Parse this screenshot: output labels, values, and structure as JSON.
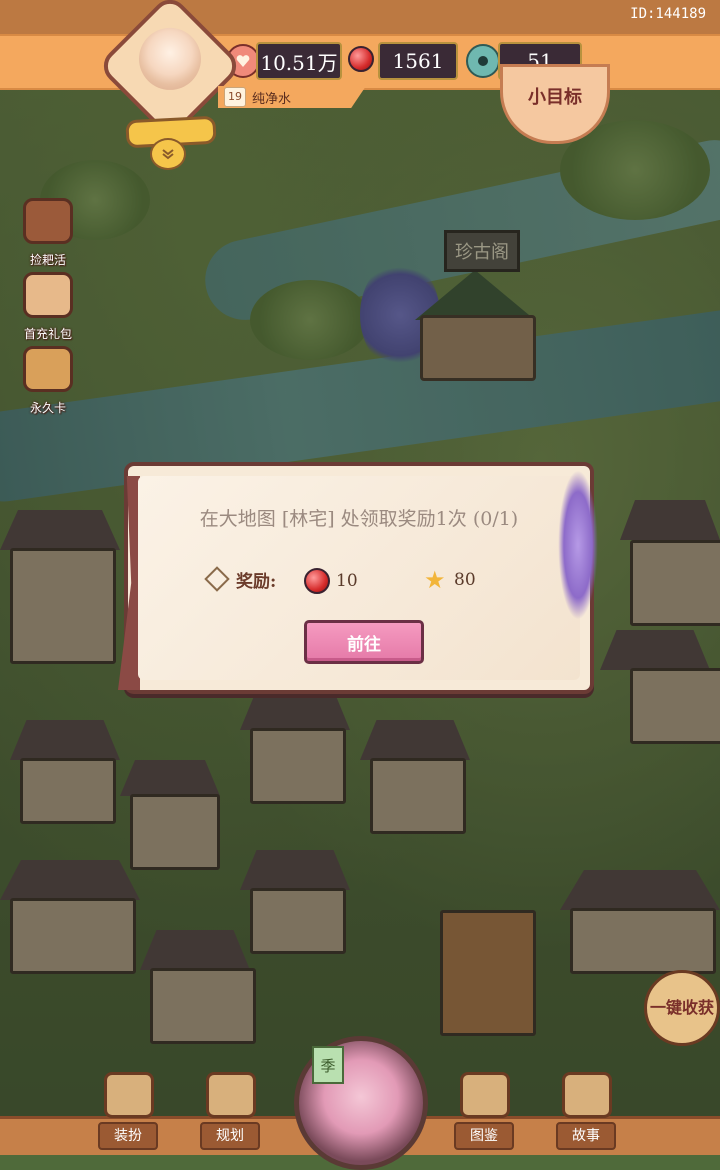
{
  "header": {
    "user_id": "ID:144189",
    "resources": [
      {
        "icon": "heart-coin-icon",
        "value": "10.51万"
      },
      {
        "icon": "red-gem-icon",
        "value": "1561"
      },
      {
        "icon": "jade-coin-icon",
        "value": "51"
      }
    ],
    "level": "19",
    "player_name": "纯净水",
    "goal_label": "小目标"
  },
  "sidebar": {
    "items": [
      {
        "label": "捡耙活"
      },
      {
        "label": "首充礼包"
      },
      {
        "label": "永久卡"
      }
    ]
  },
  "map_labels": {
    "pavilion_sign": "珍古阁",
    "collect_all": "一键收获"
  },
  "dialog": {
    "task": "在大地图 [林宅] 处领取奖励1次 (0/1)",
    "reward_label": "奖励:",
    "rewards": [
      {
        "icon": "red-gem-icon",
        "amount": "10"
      },
      {
        "icon": "star-icon",
        "amount": "80"
      }
    ],
    "go_label": "前往"
  },
  "bottom_nav": {
    "items": [
      {
        "label": "装扮"
      },
      {
        "label": "规划"
      },
      {
        "label": "图鉴"
      },
      {
        "label": "故事"
      }
    ],
    "season_label": "季"
  },
  "colors": {
    "topbar": "#f4a85e",
    "dialog_bg": "#f7ead8",
    "button_pink": "#e57aa8",
    "dialog_border": "#6b3b35"
  }
}
